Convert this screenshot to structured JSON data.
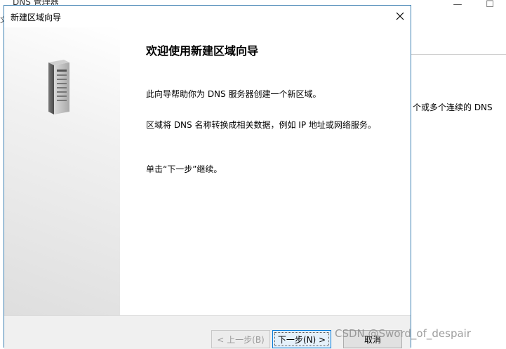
{
  "background_window": {
    "title": "DNS 管理器",
    "controls": {
      "minimize": "—",
      "maximize": "☐"
    },
    "left_glyphs": "文",
    "description_fragment": "个或多个连续的 DNS"
  },
  "wizard": {
    "title": "新建区域向导",
    "close_glyph": "✕",
    "heading": "欢迎使用新建区域向导",
    "paragraphs": [
      "此向导帮助你为 DNS 服务器创建一个新区域。",
      "区域将 DNS 名称转换成相关数据，例如 IP 地址或网络服务。",
      "单击“下一步”继续。"
    ],
    "buttons": {
      "back": "< 上一步(B)",
      "next": "下一步(N) >",
      "cancel": "取消"
    }
  },
  "watermark": "CSDN @Sword_of_despair",
  "colors": {
    "dialog_border": "#3c7fb1",
    "focus_border": "#0078d7"
  }
}
